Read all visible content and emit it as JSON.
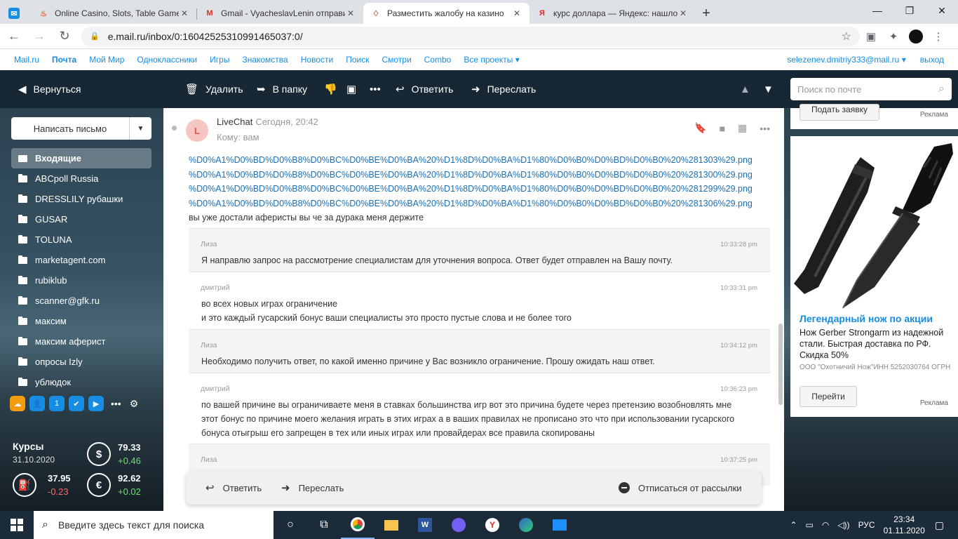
{
  "browser": {
    "tabs": [
      {
        "title": "",
        "icon": "mail-icon",
        "active": false,
        "color": "#168de2"
      },
      {
        "title": "Online Casino, Slots, Table Games",
        "icon": "casino-icon",
        "active": false,
        "color": "#f06a2b"
      },
      {
        "title": "Gmail - VyacheslavLenin отправи",
        "icon": "gmail-icon",
        "active": false,
        "color": "#d93025"
      },
      {
        "title": "Разместить жалобу на казино",
        "icon": "complaint-icon",
        "active": true,
        "color": "#c0392b"
      },
      {
        "title": "курс доллара — Яндекс: нашлос",
        "icon": "yandex-icon",
        "active": false,
        "color": "#e52620"
      }
    ],
    "url": "e.mail.ru/inbox/0:16042525310991465037:0/"
  },
  "portal": {
    "links": [
      "Mail.ru",
      "Почта",
      "Мой Мир",
      "Одноклассники",
      "Игры",
      "Знакомства",
      "Новости",
      "Поиск",
      "Смотри",
      "Combo",
      "Все проекты"
    ],
    "user": "selezenev.dmitriy333@mail.ru",
    "exit": "выход"
  },
  "mailbar": {
    "back": "Вернуться",
    "delete": "Удалить",
    "to_folder": "В папку",
    "reply": "Ответить",
    "forward": "Переслать",
    "search_placeholder": "Поиск по почте"
  },
  "sidebar": {
    "compose": "Написать письмо",
    "folders": [
      "Входящие",
      "ABCpoll Russia",
      "DRESSLILY рубашки",
      "GUSAR",
      "TOLUNA",
      "marketagent.com",
      "rubiklub",
      "scanner@gfk.ru",
      "максим",
      "максим аферист",
      "опросы Izly",
      "ублюдок"
    ],
    "rates": {
      "title": "Курсы",
      "date": "31.10.2020",
      "usd": {
        "value": "79.33",
        "change": "+0.46"
      },
      "eur": {
        "value": "92.62",
        "change": "+0.02"
      },
      "oil": {
        "value": "37.95",
        "change": "-0.23"
      }
    }
  },
  "message": {
    "avatar_letter": "L",
    "sender": "LiveChat",
    "when": "Сегодня, 20:42",
    "to": "Кому: вам",
    "links": [
      "%D0%A1%D0%BD%D0%B8%D0%BC%D0%BE%D0%BA%20%D1%8D%D0%BA%D1%80%D0%B0%D0%BD%D0%B0%20%281303%29.png",
      "%D0%A1%D0%BD%D0%B8%D0%BC%D0%BE%D0%BA%20%D1%8D%D0%BA%D1%80%D0%B0%D0%BD%D0%B0%20%281300%29.png",
      "%D0%A1%D0%BD%D0%B8%D0%BC%D0%BE%D0%BA%20%D1%8D%D0%BA%D1%80%D0%B0%D0%BD%D0%B0%20%281299%29.png",
      "%D0%A1%D0%BD%D0%B8%D0%BC%D0%BE%D0%BA%20%D1%8D%D0%BA%D1%80%D0%B0%D0%BD%D0%B0%20%281306%29.png"
    ],
    "text": "вы уже достали аферисты вы че за дурака меня держите",
    "chat": [
      {
        "who": "Лиза",
        "time": "10:33:28 pm",
        "op": true,
        "lines": [
          "Я направлю запрос на рассмотрение специалистам для уточнения вопроса. Ответ будет отправлен на Вашу почту."
        ]
      },
      {
        "who": "дмитрий",
        "time": "10:33:31 pm",
        "op": false,
        "lines": [
          "во всех новых играх ограничение",
          "и это каждый гусарский бонус ваши специалисты это просто пустые слова и не более того"
        ]
      },
      {
        "who": "Лиза",
        "time": "10:34:12 pm",
        "op": true,
        "lines": [
          "Необходимо получить ответ, по какой именно причине у Вас возникло ограничение. Прошу ожидать наш ответ."
        ]
      },
      {
        "who": "дмитрий",
        "time": "10:36:23 pm",
        "op": false,
        "lines": [
          "по вашей причине вы ограничиваете меня в ставках большинства игр вот это причина будете через претензию возобновлять мне",
          "этот бонус по причине моего желания играть в этих играх а в ваших правилах не прописано это что при использовании гусарского",
          "бонуса отыгрыш его запрещен в тех или иных играх или провайдерах все правила скопированы"
        ]
      },
      {
        "who": "Лиза",
        "time": "10:37:25 pm",
        "op": true,
        "lines": [
          ""
        ]
      }
    ]
  },
  "actions": {
    "reply": "Ответить",
    "forward": "Переслать",
    "unsubscribe": "Отписаться от рассылки"
  },
  "ads": {
    "top_button": "Подать заявку",
    "label": "Реклама",
    "headline": "Легендарный нож по акции",
    "desc": "Нож Gerber Strongarm из надежной стали. Быстрая доставка по РФ. Скидка 50%",
    "org": "ООО \"Охотничий Нож\"ИНН 5252030764 ОГРН",
    "button": "Перейти"
  },
  "taskbar": {
    "search_placeholder": "Введите здесь текст для поиска",
    "lang": "РУС",
    "time": "23:34",
    "date": "01.11.2020"
  }
}
